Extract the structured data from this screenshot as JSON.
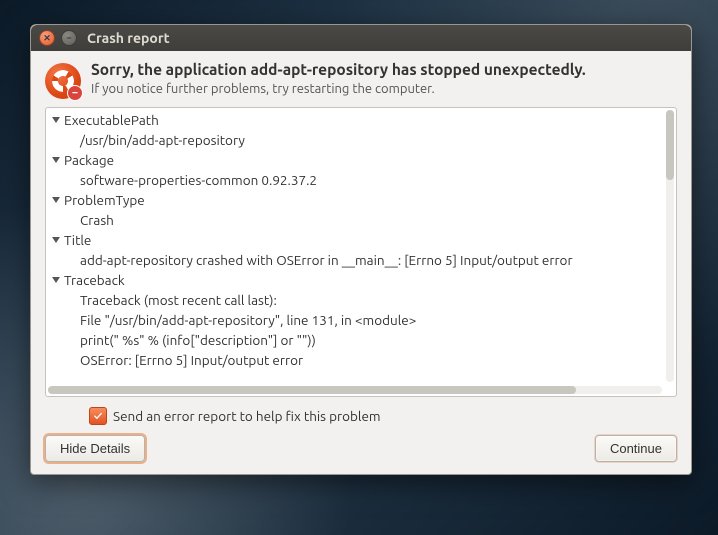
{
  "window": {
    "title": "Crash report"
  },
  "header": {
    "heading": "Sorry, the application add-apt-repository has stopped unexpectedly.",
    "subtext": "If you notice further problems, try restarting the computer."
  },
  "details": {
    "items": [
      {
        "key": "ExecutablePath",
        "value": "/usr/bin/add-apt-repository"
      },
      {
        "key": "Package",
        "value": "software-properties-common 0.92.37.2"
      },
      {
        "key": "ProblemType",
        "value": "Crash"
      },
      {
        "key": "Title",
        "value": "add-apt-repository crashed with OSError in __main__: [Errno 5] Input/output error"
      },
      {
        "key": "Traceback",
        "value_lines": [
          "Traceback (most recent call last):",
          "  File \"/usr/bin/add-apt-repository\", line 131, in <module>",
          "    print(\" %s\" % (info[\"description\"] or \"\"))",
          "OSError: [Errno 5] Input/output error"
        ]
      }
    ]
  },
  "checkbox": {
    "checked": true,
    "label": "Send an error report to help fix this problem"
  },
  "buttons": {
    "hide_details": "Hide Details",
    "continue": "Continue"
  }
}
